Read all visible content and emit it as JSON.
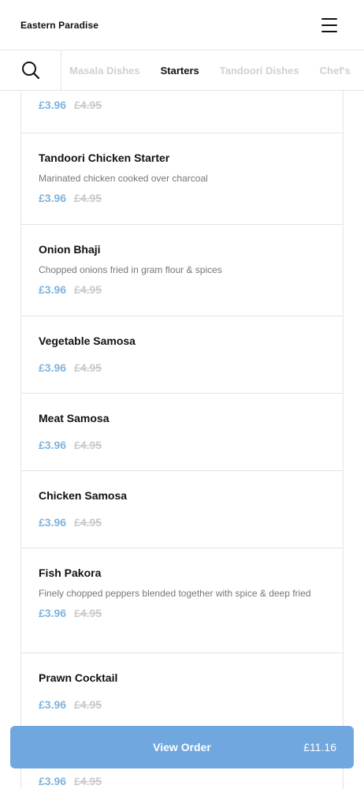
{
  "header": {
    "brand": "Eastern Paradise",
    "menu_icon": "hamburger-icon"
  },
  "categories": {
    "search_icon": "search-icon",
    "tabs": [
      {
        "label": "Masala Dishes",
        "active": false
      },
      {
        "label": "Starters",
        "active": true
      },
      {
        "label": "Tandoori Dishes",
        "active": false
      },
      {
        "label": "Chef's",
        "active": false
      }
    ]
  },
  "menu_items": [
    {
      "name": "",
      "description": "",
      "price": "£3.96",
      "old_price": "£4.95"
    },
    {
      "name": "Tandoori Chicken Starter",
      "description": "Marinated chicken cooked over charcoal",
      "price": "£3.96",
      "old_price": "£4.95"
    },
    {
      "name": "Onion Bhaji",
      "description": "Chopped onions fried in gram flour & spices",
      "price": "£3.96",
      "old_price": "£4.95"
    },
    {
      "name": "Vegetable Samosa",
      "description": "",
      "price": "£3.96",
      "old_price": "£4.95"
    },
    {
      "name": "Meat Samosa",
      "description": "",
      "price": "£3.96",
      "old_price": "£4.95"
    },
    {
      "name": "Chicken Samosa",
      "description": "",
      "price": "£3.96",
      "old_price": "£4.95"
    },
    {
      "name": "Fish Pakora",
      "description": "Finely chopped peppers blended together with spice & deep fried",
      "price": "£3.96",
      "old_price": "£4.95"
    },
    {
      "name": "Prawn Cocktail",
      "description": "",
      "price": "£3.96",
      "old_price": "£4.95"
    },
    {
      "name": "",
      "description": "",
      "price": "£3.96",
      "old_price": "£4.95"
    }
  ],
  "order_bar": {
    "label": "View Order",
    "total": "£11.16"
  },
  "colors": {
    "accent": "#6fa7de",
    "price": "#7fb3df",
    "strike": "#c8c8c8"
  }
}
